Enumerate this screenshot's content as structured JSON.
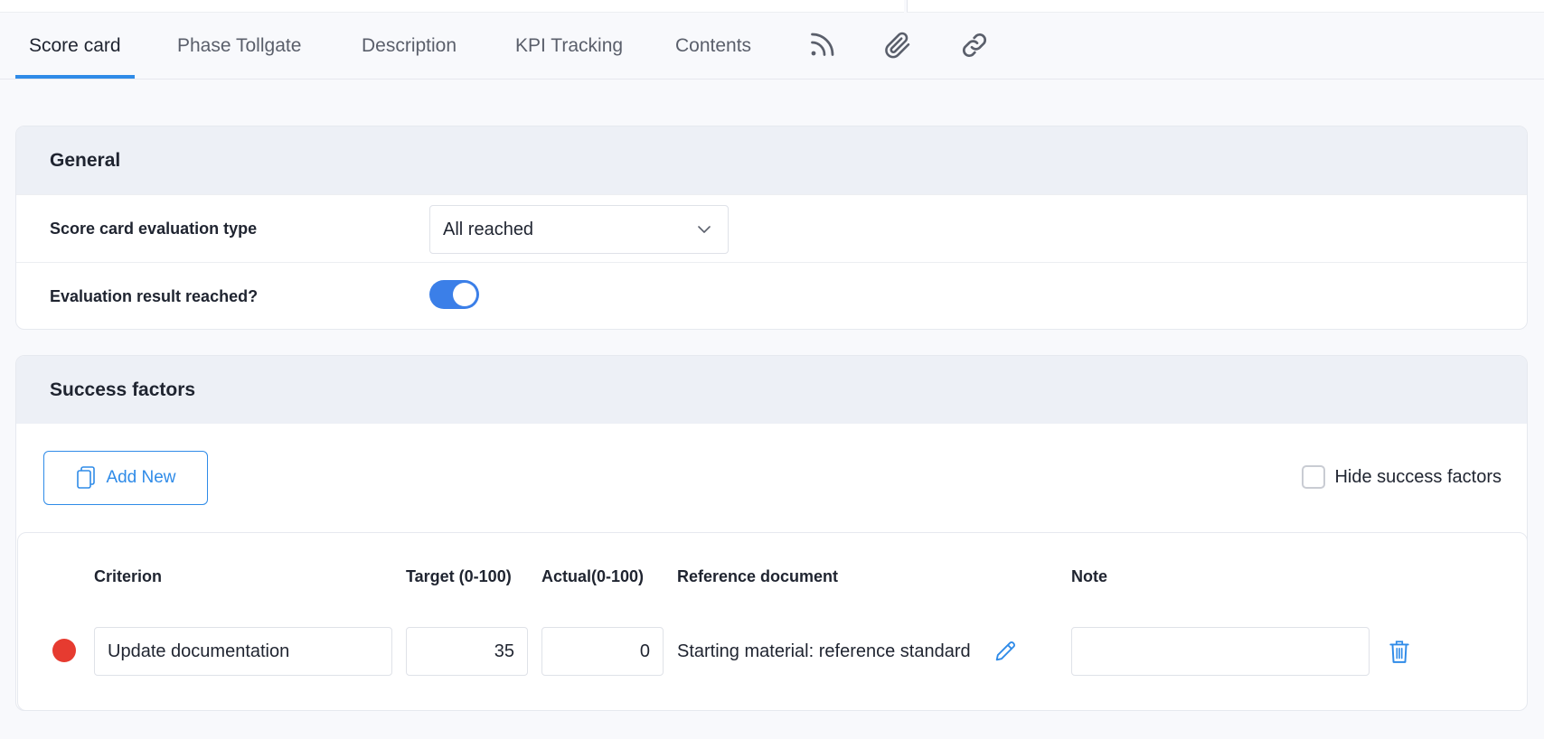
{
  "tabs": [
    {
      "label": "Score card",
      "active": true
    },
    {
      "label": "Phase Tollgate"
    },
    {
      "label": "Description"
    },
    {
      "label": "KPI Tracking"
    },
    {
      "label": "Contents"
    }
  ],
  "tab_icons": [
    "rss-feed-icon",
    "paperclip-icon",
    "link-icon"
  ],
  "general": {
    "title": "General",
    "evaluation_type_label": "Score card evaluation type",
    "evaluation_type_value": "All reached",
    "result_reached_label": "Evaluation result reached?",
    "result_reached": true
  },
  "success_factors": {
    "title": "Success factors",
    "add_new_label": "Add New",
    "hide_label": "Hide success factors",
    "hide_checked": false,
    "columns": {
      "criterion": "Criterion",
      "target": "Target (0-100)",
      "actual": "Actual(0-100)",
      "reference": "Reference document",
      "note": "Note"
    },
    "rows": [
      {
        "status_color": "#e63b30",
        "criterion": "Update documentation",
        "target": "35",
        "actual": "0",
        "reference": "Starting material: reference standard",
        "note": ""
      }
    ]
  },
  "colors": {
    "accent": "#2f8be8",
    "toggle_on": "#3b7fe8",
    "status_red": "#e63b30"
  }
}
